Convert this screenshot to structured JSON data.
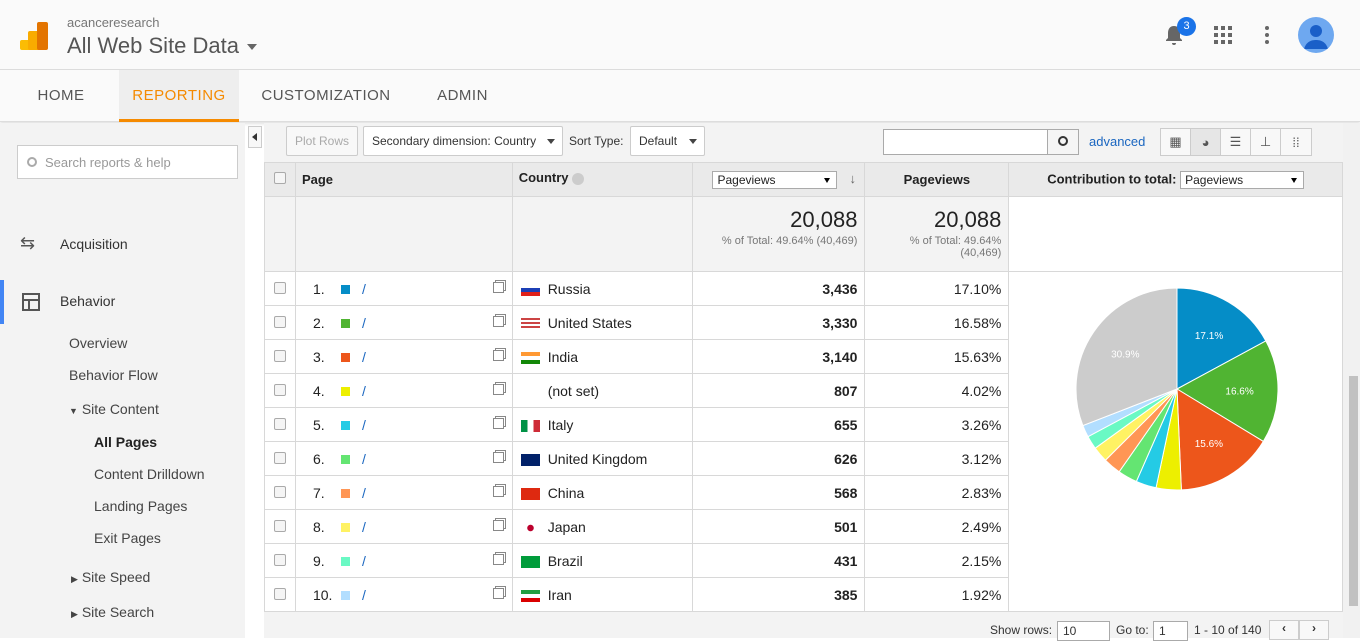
{
  "header": {
    "account": "acanceresearch",
    "property": "All Web Site Data",
    "notifications": "3"
  },
  "nav": {
    "tabs": [
      "HOME",
      "REPORTING",
      "CUSTOMIZATION",
      "ADMIN"
    ],
    "active": "REPORTING",
    "accent": "#f58a00"
  },
  "sidebar": {
    "search_placeholder": "Search reports & help",
    "acquisition": "Acquisition",
    "behavior": "Behavior",
    "overview": "Overview",
    "behavior_flow": "Behavior Flow",
    "site_content": "Site Content",
    "all_pages": "All Pages",
    "content_drilldown": "Content Drilldown",
    "landing_pages": "Landing Pages",
    "exit_pages": "Exit Pages",
    "site_speed": "Site Speed",
    "site_search": "Site Search"
  },
  "toolbar": {
    "plot_rows": "Plot Rows",
    "secondary_dimension": "Secondary dimension: Country",
    "sort_type_label": "Sort Type:",
    "sort_type": "Default",
    "advanced": "advanced"
  },
  "table": {
    "headers": {
      "page": "Page",
      "country": "Country",
      "metric_select": "Pageviews",
      "pageviews": "Pageviews",
      "contribution_label": "Contribution to total:",
      "contribution_select": "Pageviews"
    },
    "totals": {
      "value": "20,088",
      "sub": "% of Total: 49.64% (40,469)",
      "value2": "20,088",
      "sub2a": "% of Total: 49.64%",
      "sub2b": "(40,469)"
    },
    "rows": [
      {
        "n": "1.",
        "page": "/",
        "country": "Russia",
        "pageviews": "3,436",
        "pct": "17.10%",
        "color": "#058dc7",
        "flag": "ru"
      },
      {
        "n": "2.",
        "page": "/",
        "country": "United States",
        "pageviews": "3,330",
        "pct": "16.58%",
        "color": "#50b432",
        "flag": "us"
      },
      {
        "n": "3.",
        "page": "/",
        "country": "India",
        "pageviews": "3,140",
        "pct": "15.63%",
        "color": "#ed561b",
        "flag": "in"
      },
      {
        "n": "4.",
        "page": "/",
        "country": "(not set)",
        "pageviews": "807",
        "pct": "4.02%",
        "color": "#edef00",
        "flag": ""
      },
      {
        "n": "5.",
        "page": "/",
        "country": "Italy",
        "pageviews": "655",
        "pct": "3.26%",
        "color": "#24cbe5",
        "flag": "it"
      },
      {
        "n": "6.",
        "page": "/",
        "country": "United Kingdom",
        "pageviews": "626",
        "pct": "3.12%",
        "color": "#64e572",
        "flag": "gb"
      },
      {
        "n": "7.",
        "page": "/",
        "country": "China",
        "pageviews": "568",
        "pct": "2.83%",
        "color": "#ff9655",
        "flag": "cn"
      },
      {
        "n": "8.",
        "page": "/",
        "country": "Japan",
        "pageviews": "501",
        "pct": "2.49%",
        "color": "#fff263",
        "flag": "jp"
      },
      {
        "n": "9.",
        "page": "/",
        "country": "Brazil",
        "pageviews": "431",
        "pct": "2.15%",
        "color": "#6af9c4",
        "flag": "br"
      },
      {
        "n": "10.",
        "page": "/",
        "country": "Iran",
        "pageviews": "385",
        "pct": "1.92%",
        "color": "#b2deff",
        "flag": "ir"
      }
    ]
  },
  "chart_data": {
    "type": "pie",
    "values": [
      17.1,
      16.58,
      15.63,
      4.02,
      3.26,
      3.12,
      2.83,
      2.49,
      2.15,
      1.92,
      30.9
    ],
    "labels": [
      "17.1%",
      "16.6%",
      "15.6%",
      "",
      "",
      "",
      "",
      "",
      "",
      "",
      "30.9%"
    ],
    "colors": [
      "#058dc7",
      "#50b432",
      "#ed561b",
      "#edef00",
      "#24cbe5",
      "#64e572",
      "#ff9655",
      "#fff263",
      "#6af9c4",
      "#b2deff",
      "#cccccc"
    ]
  },
  "pager": {
    "show_rows_label": "Show rows:",
    "show_rows": "10",
    "goto_label": "Go to:",
    "goto": "1",
    "range": "1 - 10 of 140"
  }
}
